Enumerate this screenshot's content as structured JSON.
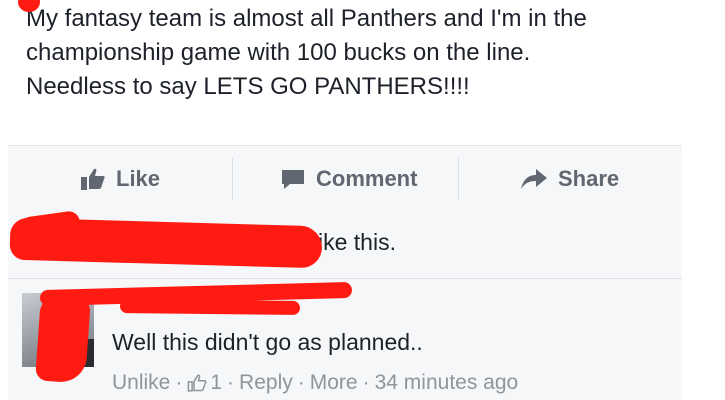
{
  "post": {
    "lines": [
      "My fantasy team is almost all Panthers and I'm in the",
      "championship game with 100 bucks on the line.",
      "Needless to say LETS GO PANTHERS!!!!"
    ]
  },
  "actions": {
    "like": "Like",
    "comment": "Comment",
    "share": "Share"
  },
  "likes_summary": {
    "visible_text": "ike this."
  },
  "comment": {
    "text": "Well this didn't go as planned..",
    "unlike": "Unlike",
    "like_count": "1",
    "reply": "Reply",
    "more": "More",
    "time": "34 minutes ago",
    "separator": "·"
  },
  "colors": {
    "redaction": "#ff1a12",
    "action_gray": "#616770",
    "meta_gray": "#90949c",
    "panel_bg": "#f6f7f9"
  },
  "icons": [
    "thumbs-up-icon",
    "comment-bubble-icon",
    "share-arrow-icon",
    "small-thumbs-up-icon"
  ]
}
